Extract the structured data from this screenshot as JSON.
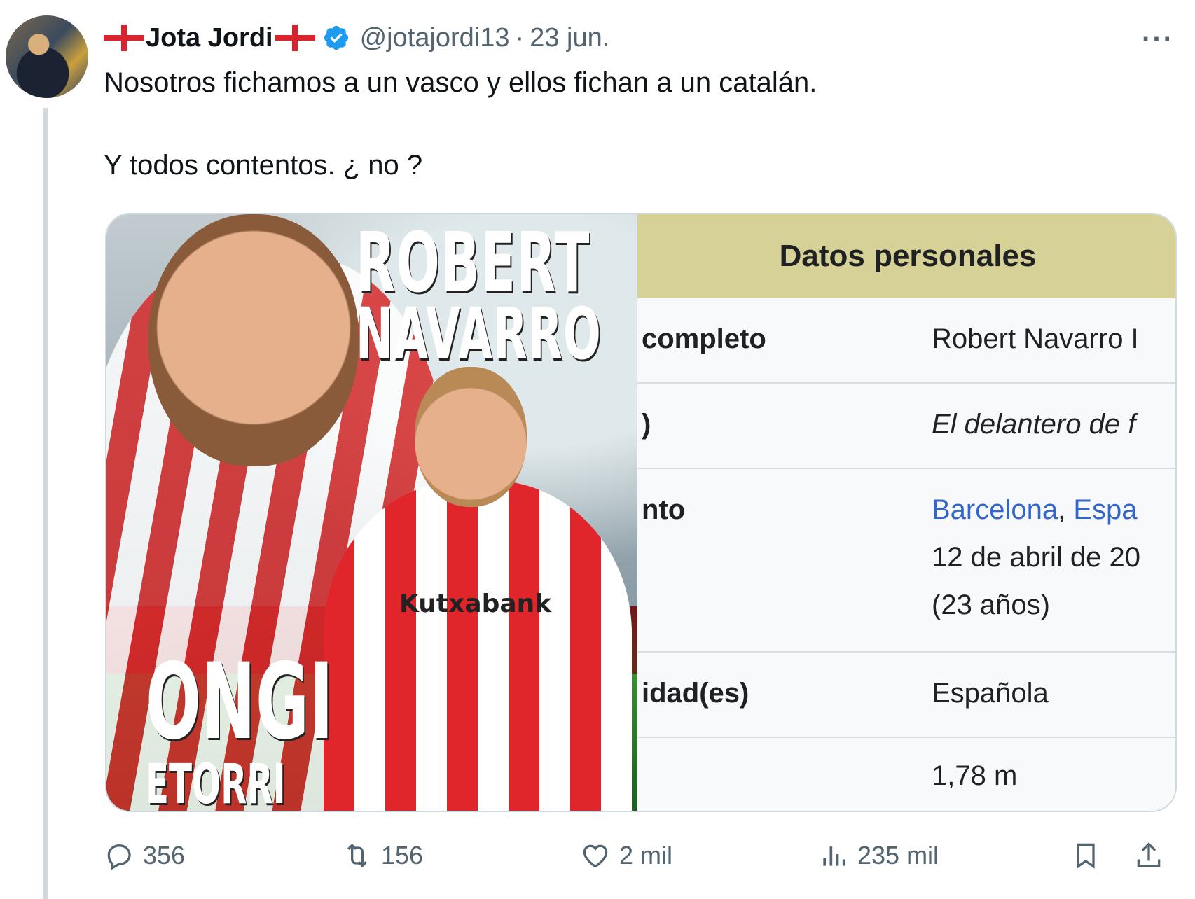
{
  "tweet": {
    "author_name": "Jota Jordi",
    "handle": "@jotajordi13",
    "separator": "·",
    "date": "23 jun.",
    "more_label": "···",
    "text_line1": "Nosotros fichamos a un vasco y ellos fichan a un catalán.",
    "text_line2": "Y todos contentos. ¿ no ?"
  },
  "poster": {
    "title_first": "ROBERT",
    "title_last": "NAVARRO",
    "sponsor": "Kutxabank",
    "welcome_1": "ONGI",
    "welcome_2": "ETORRI"
  },
  "infobox": {
    "header": "Datos personales",
    "rows": [
      {
        "label": "completo",
        "value": "Robert Navarro I"
      },
      {
        "label": ")",
        "value": "El delantero de f"
      },
      {
        "label": "nto",
        "value_link1": "Barcelona",
        "value_sep": ", ",
        "value_link2": "Espa",
        "value_line2": "12 de abril de 20",
        "value_line3": "(23 años)"
      },
      {
        "label": "idad(es)",
        "value": "Española"
      },
      {
        "label": "",
        "value": "1,78 m"
      }
    ]
  },
  "actions": {
    "replies": "356",
    "retweets": "156",
    "likes": "2 mil",
    "views": "235 mil"
  },
  "colors": {
    "verified_blue": "#1d9bf0",
    "flag_red": "#d9232e",
    "infobox_header": "#d6d196",
    "link_blue": "#3366cc",
    "muted_text": "#536471"
  },
  "icons": [
    "flag-icon",
    "verified-icon",
    "more-icon",
    "reply-icon",
    "retweet-icon",
    "like-icon",
    "views-icon",
    "bookmark-icon",
    "share-icon"
  ]
}
